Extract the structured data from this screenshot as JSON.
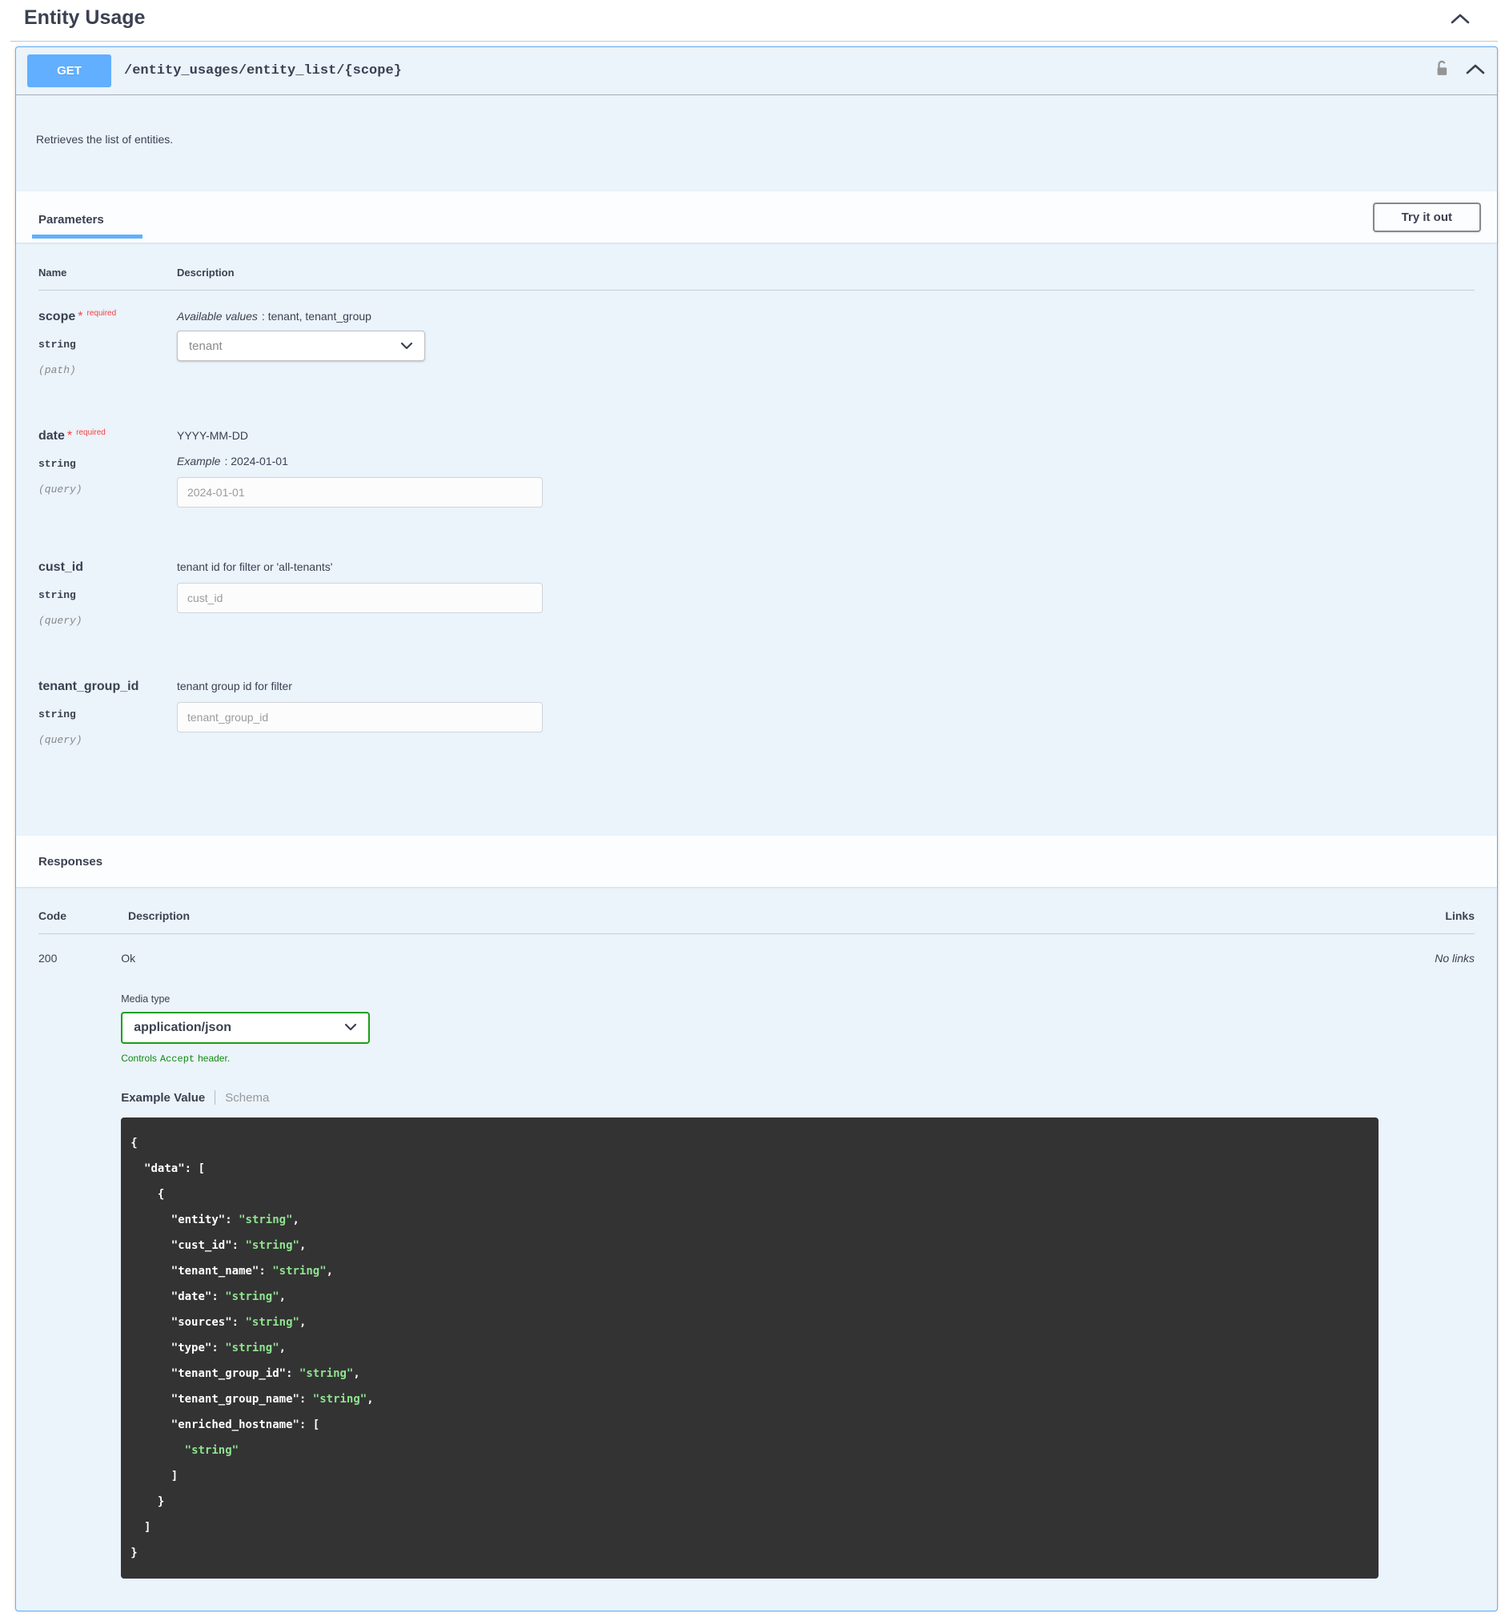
{
  "tag": {
    "title": "Entity Usage"
  },
  "operation": {
    "method": "GET",
    "path": "/entity_usages/entity_list/{scope}",
    "description": "Retrieves the list of entities."
  },
  "parameters": {
    "tab_label": "Parameters",
    "try_it_out": "Try it out",
    "col_name": "Name",
    "col_description": "Description",
    "rows": [
      {
        "name": "scope",
        "required_star": "*",
        "required_label": "required",
        "type": "string",
        "location": "(path)",
        "desc_em": "Available values",
        "desc_rest": ": tenant, tenant_group",
        "control_value": "tenant"
      },
      {
        "name": "date",
        "required_star": "*",
        "required_label": "required",
        "type": "string",
        "location": "(query)",
        "desc_line1": "YYYY-MM-DD",
        "desc_em": "Example",
        "desc_rest": ": 2024-01-01",
        "placeholder": "2024-01-01"
      },
      {
        "name": "cust_id",
        "type": "string",
        "location": "(query)",
        "desc_line1": "tenant id for filter or 'all-tenants'",
        "placeholder": "cust_id"
      },
      {
        "name": "tenant_group_id",
        "type": "string",
        "location": "(query)",
        "desc_line1": "tenant group id for filter",
        "placeholder": "tenant_group_id"
      }
    ]
  },
  "responses": {
    "section_label": "Responses",
    "col_code": "Code",
    "col_description": "Description",
    "col_links": "Links",
    "row": {
      "code": "200",
      "description": "Ok",
      "links": "No links"
    },
    "media_type": {
      "label": "Media type",
      "value": "application/json",
      "note_prefix": "Controls",
      "note_code": "Accept",
      "note_suffix": "header."
    },
    "tabs": {
      "example": "Example Value",
      "schema": "Schema"
    },
    "example_json": {
      "lines": [
        {
          "t": "{"
        },
        {
          "t": "  \"data\": ["
        },
        {
          "t": "    {"
        },
        {
          "k": "      \"entity\": ",
          "v": "\"string\"",
          "c": ","
        },
        {
          "k": "      \"cust_id\": ",
          "v": "\"string\"",
          "c": ","
        },
        {
          "k": "      \"tenant_name\": ",
          "v": "\"string\"",
          "c": ","
        },
        {
          "k": "      \"date\": ",
          "v": "\"string\"",
          "c": ","
        },
        {
          "k": "      \"sources\": ",
          "v": "\"string\"",
          "c": ","
        },
        {
          "k": "      \"type\": ",
          "v": "\"string\"",
          "c": ","
        },
        {
          "k": "      \"tenant_group_id\": ",
          "v": "\"string\"",
          "c": ","
        },
        {
          "k": "      \"tenant_group_name\": ",
          "v": "\"string\"",
          "c": ","
        },
        {
          "t": "      \"enriched_hostname\": ["
        },
        {
          "k": "        ",
          "v": "\"string\""
        },
        {
          "t": "      ]"
        },
        {
          "t": "    }"
        },
        {
          "t": "  ]"
        },
        {
          "t": "}"
        }
      ]
    }
  },
  "colors": {
    "accent_blue": "#61affe",
    "required_red": "#f93e3e",
    "media_green": "#17a017",
    "code_string_green": "#8fe38f",
    "code_background": "#333333",
    "text_main": "#3b4151"
  }
}
